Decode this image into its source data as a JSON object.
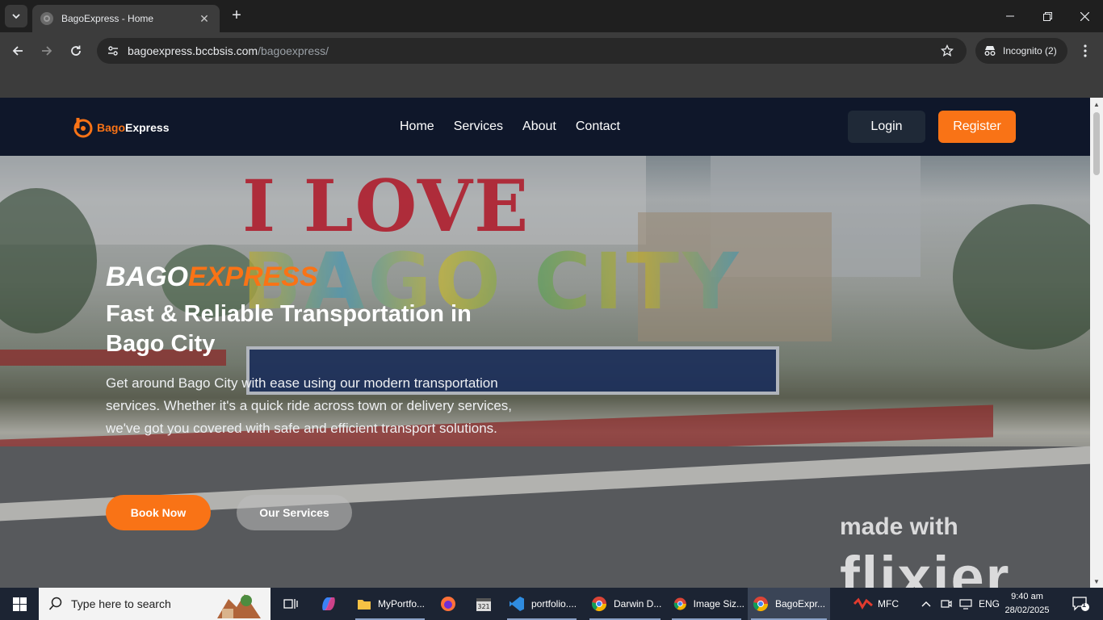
{
  "browser": {
    "tab_title": "BagoExpress - Home",
    "url_host": "bagoexpress.bccbsis.com",
    "url_path": "/bagoexpress/",
    "incognito_label": "Incognito (2)"
  },
  "site": {
    "logo_b": "Bago",
    "logo_e": "Express",
    "nav": [
      "Home",
      "Services",
      "About",
      "Contact"
    ],
    "login_label": "Login",
    "register_label": "Register"
  },
  "hero": {
    "brand_white": "BAGO",
    "brand_orange": "EXPRESS",
    "title": "Fast & Reliable Transportation in Bago City",
    "description": "Get around Bago City with ease using our modern transportation services. Whether it's a quick ride across town or delivery services, we've got you covered with safe and efficient transport solutions.",
    "book_label": "Book Now",
    "services_label": "Our Services",
    "watermark_line1": "made with",
    "watermark_line2": "flixier",
    "photo_sign_line1": "I LOVE",
    "photo_sign_line2": "BAGO CITY"
  },
  "taskbar": {
    "search_placeholder": "Type here to search",
    "apps": [
      {
        "label": "MyPortfo...",
        "icon": "folder-icon"
      },
      {
        "label": "portfolio....",
        "icon": "vscode-icon"
      },
      {
        "label": "Darwin D...",
        "icon": "chrome-icon"
      },
      {
        "label": "Image Siz...",
        "icon": "chrome-icon"
      },
      {
        "label": "BagoExpr...",
        "icon": "chrome-icon"
      }
    ],
    "weather_label": "MFC",
    "language": "ENG",
    "time": "9:40 am",
    "date": "28/02/2025",
    "notification_count": "1"
  },
  "colors": {
    "accent": "#f97316",
    "header_bg": "#0f172a",
    "login_bg": "#1f2937"
  }
}
